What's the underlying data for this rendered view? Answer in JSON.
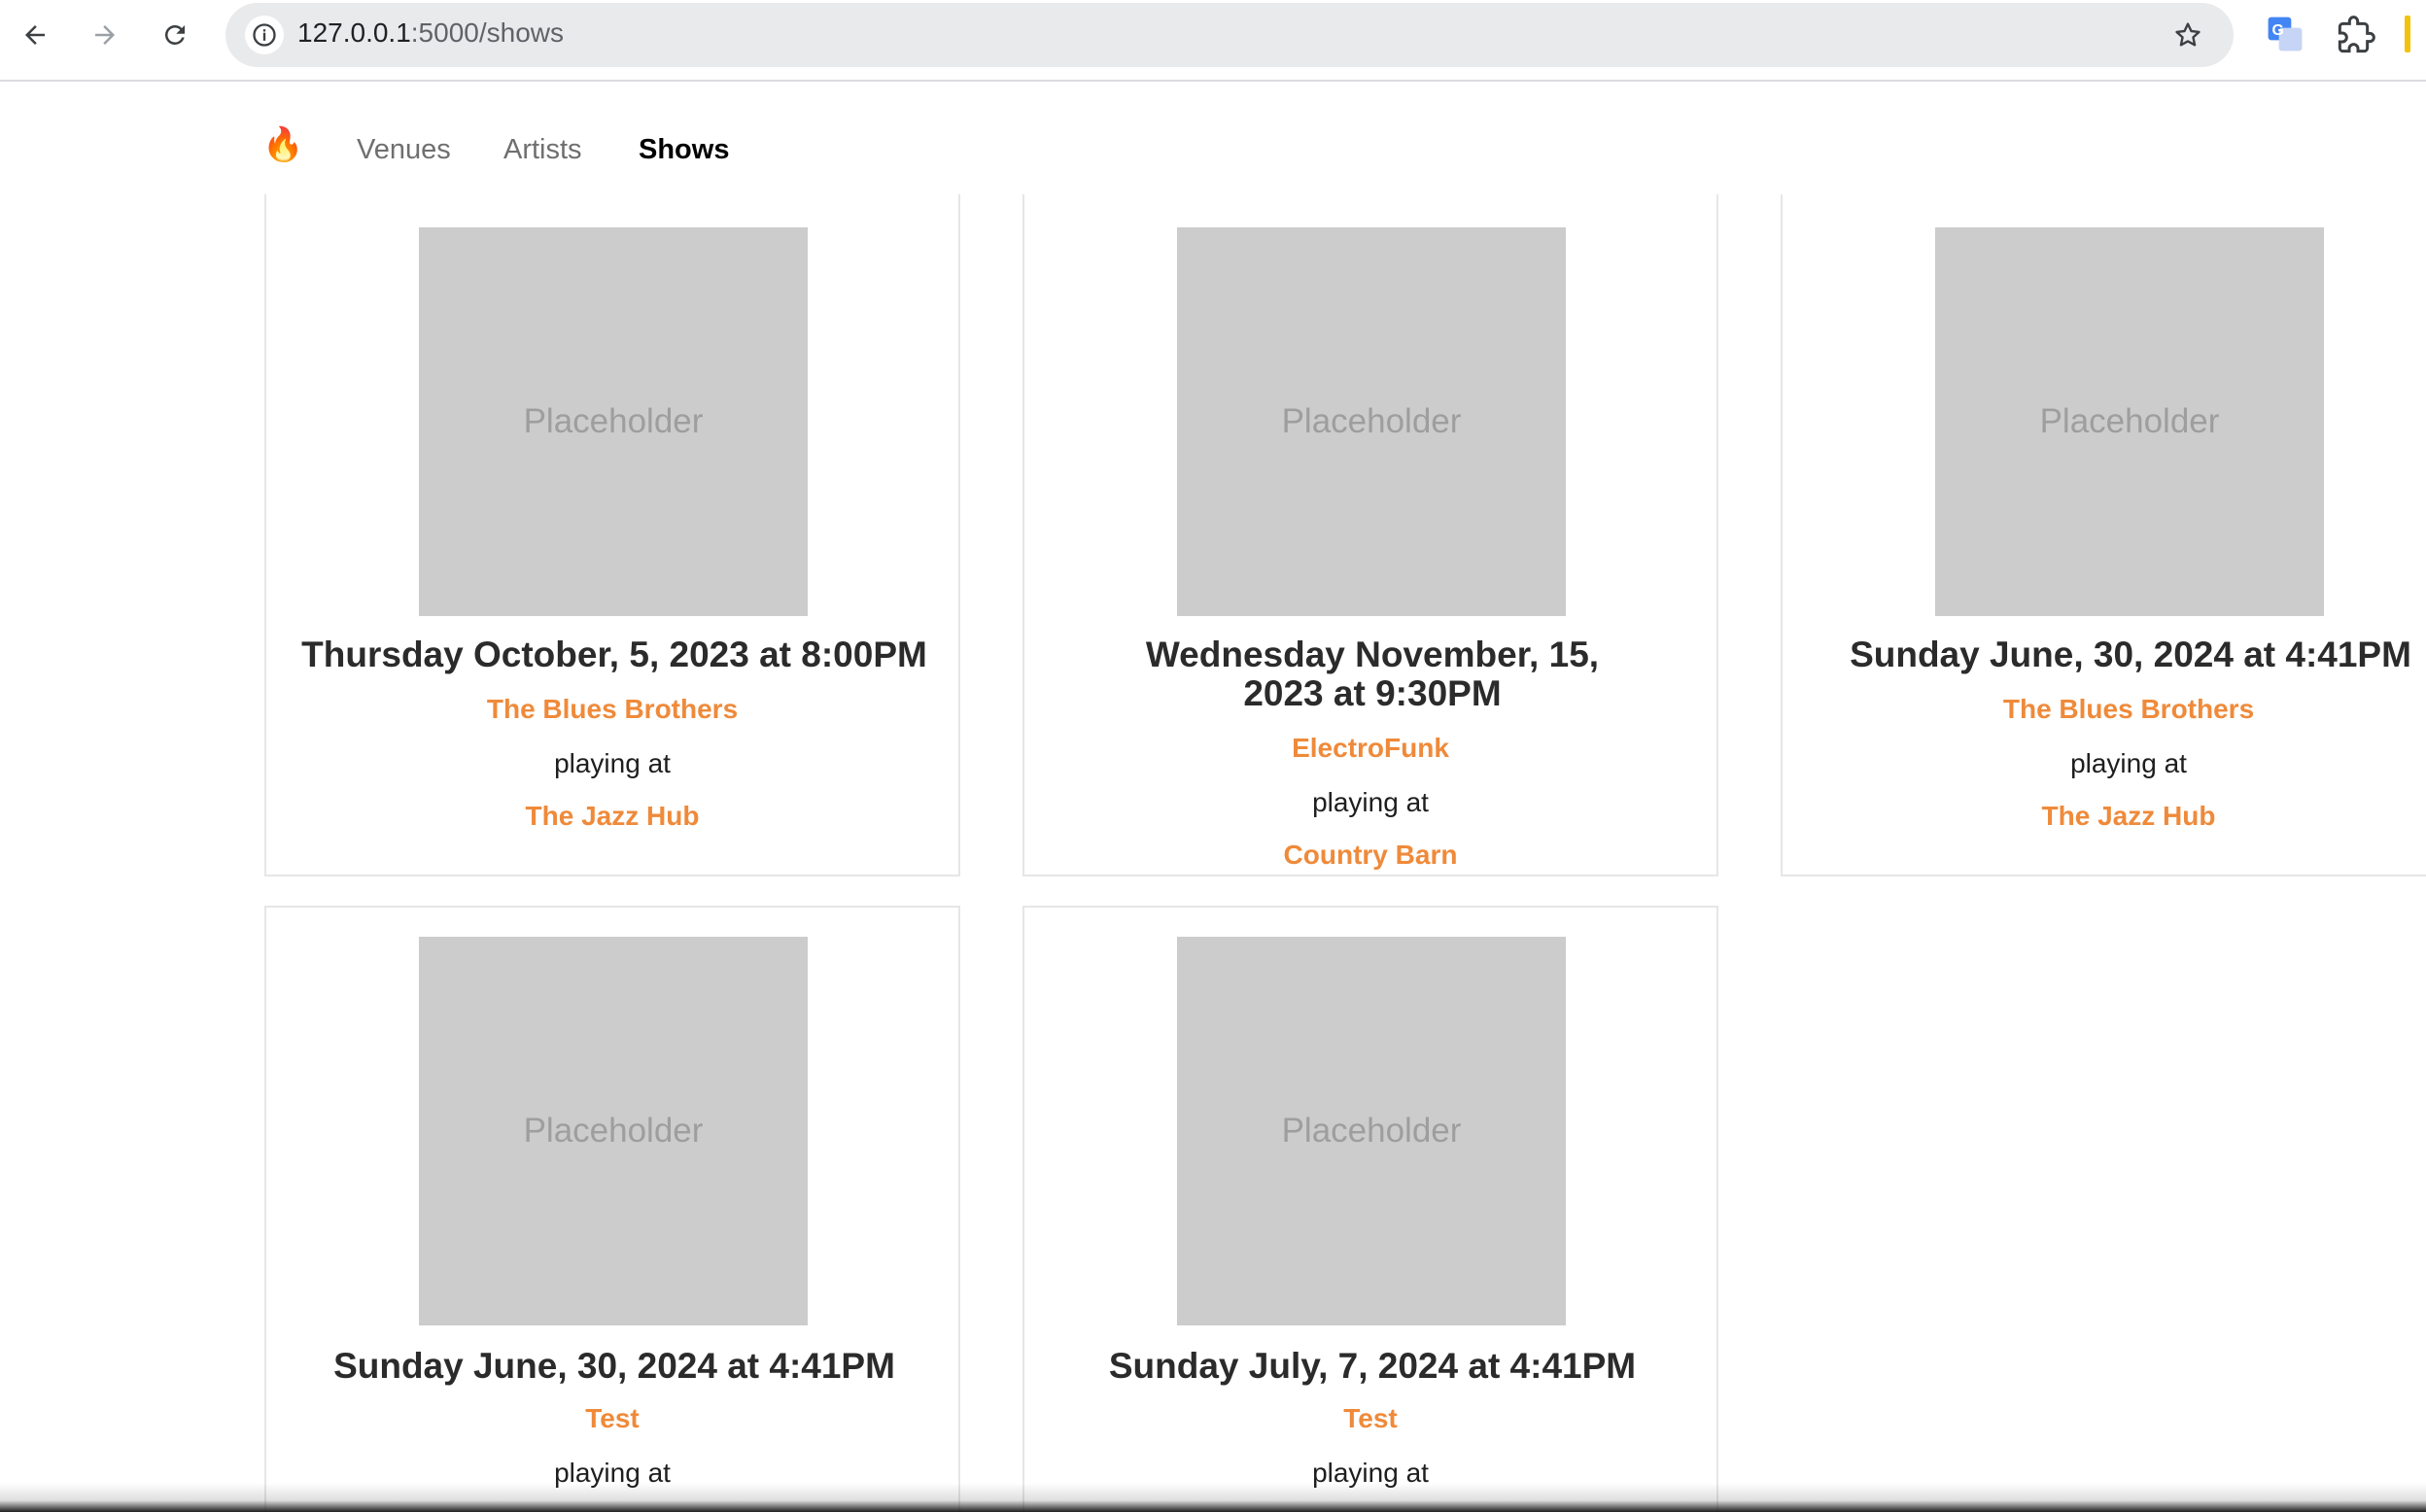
{
  "browser": {
    "url_host": "127.0.0.1",
    "url_path": ":5000/shows",
    "back_icon": "arrow-left-icon",
    "forward_icon": "arrow-right-icon",
    "reload_icon": "reload-icon",
    "bookmark_icon": "star-icon"
  },
  "nav": {
    "brand_icon": "🔥",
    "links": [
      {
        "label": "Venues"
      },
      {
        "label": "Artists"
      },
      {
        "label": "Shows"
      }
    ]
  },
  "shows": [
    {
      "image_label": "Placeholder",
      "date": "Thursday October, 5, 2023 at 8:00PM",
      "artist": "The Blues Brothers",
      "playing_at": "playing at",
      "venue": "The Jazz Hub"
    },
    {
      "image_label": "Placeholder",
      "date": "Wednesday November, 15, 2023 at 9:30PM",
      "artist": "ElectroFunk",
      "playing_at": "playing at",
      "venue": "Country Barn"
    },
    {
      "image_label": "Placeholder",
      "date": "Sunday June, 30, 2024 at 4:41PM",
      "artist": "The Blues Brothers",
      "playing_at": "playing at",
      "venue": "The Jazz Hub"
    },
    {
      "image_label": "Placeholder",
      "date": "Sunday June, 30, 2024 at 4:41PM",
      "artist": "Test",
      "playing_at": "playing at",
      "venue": ""
    },
    {
      "image_label": "Placeholder",
      "date": "Sunday July, 7, 2024 at 4:41PM",
      "artist": "Test",
      "playing_at": "playing at",
      "venue": ""
    }
  ],
  "colors": {
    "accent": "#ef8a3a",
    "placeholder_bg": "#cccccc"
  }
}
